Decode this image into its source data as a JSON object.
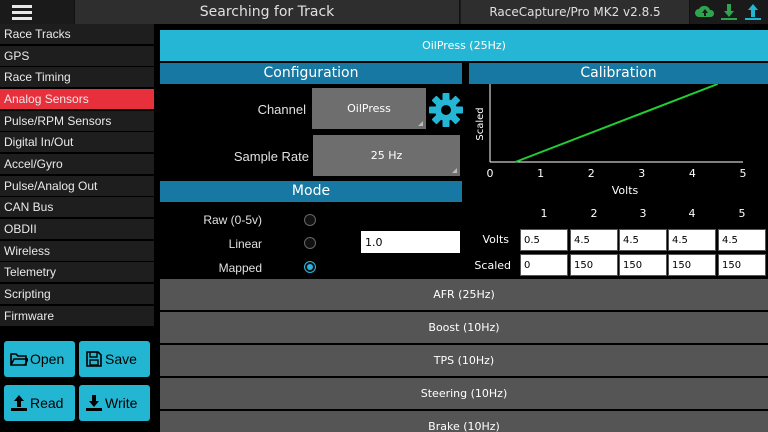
{
  "topbar": {
    "title": "Searching for Track",
    "version": "RaceCapture/Pro MK2 v2.8.5",
    "icons": [
      "menu-icon",
      "cloud-upload-icon",
      "download-icon",
      "upload-icon"
    ]
  },
  "sidebar": {
    "items": [
      {
        "label": "Race Tracks",
        "active": false
      },
      {
        "label": "GPS",
        "active": false
      },
      {
        "label": "Race Timing",
        "active": false
      },
      {
        "label": "Analog Sensors",
        "active": true
      },
      {
        "label": "Pulse/RPM Sensors",
        "active": false
      },
      {
        "label": "Digital In/Out",
        "active": false
      },
      {
        "label": "Accel/Gyro",
        "active": false
      },
      {
        "label": "Pulse/Analog Out",
        "active": false
      },
      {
        "label": "CAN Bus",
        "active": false
      },
      {
        "label": "OBDII",
        "active": false
      },
      {
        "label": "Wireless",
        "active": false
      },
      {
        "label": "Telemetry",
        "active": false
      },
      {
        "label": "Scripting",
        "active": false
      },
      {
        "label": "Firmware",
        "active": false
      }
    ],
    "buttons": {
      "open": "Open",
      "save": "Save",
      "read": "Read",
      "write": "Write"
    }
  },
  "channel": {
    "header": "OilPress (25Hz)"
  },
  "config": {
    "title": "Configuration",
    "channel_label": "Channel",
    "channel_value": "OilPress",
    "sample_rate_label": "Sample Rate",
    "sample_rate_value": "25 Hz"
  },
  "mode": {
    "title": "Mode",
    "options": [
      {
        "label": "Raw (0-5v)",
        "selected": false
      },
      {
        "label": "Linear",
        "selected": false
      },
      {
        "label": "Mapped",
        "selected": true
      }
    ],
    "linear_value": "1.0"
  },
  "calibration": {
    "title": "Calibration",
    "columns": [
      "1",
      "2",
      "3",
      "4",
      "5"
    ],
    "rows": [
      {
        "label": "Volts",
        "values": [
          "0.5",
          "4.5",
          "4.5",
          "4.5",
          "4.5"
        ]
      },
      {
        "label": "Scaled",
        "values": [
          "0",
          "150",
          "150",
          "150",
          "150"
        ]
      }
    ]
  },
  "chart_data": {
    "type": "line",
    "xlabel": "Volts",
    "ylabel": "Scaled",
    "xticks": [
      "0",
      "1",
      "2",
      "3",
      "4",
      "5"
    ],
    "xlim": [
      0,
      5
    ],
    "ylim": [
      0,
      150
    ],
    "series": [
      {
        "x": [
          0.5,
          4.5
        ],
        "values": [
          0,
          150
        ],
        "color": "#22cc33"
      }
    ]
  },
  "other_channels": [
    {
      "label": "AFR (25Hz)"
    },
    {
      "label": "Boost (10Hz)"
    },
    {
      "label": "TPS (10Hz)"
    },
    {
      "label": "Steering (10Hz)"
    },
    {
      "label": "Brake (10Hz)"
    }
  ],
  "colors": {
    "accent": "#24b6d4",
    "section": "#1779a3",
    "active_item": "#e8303c",
    "top_icons": "#2ea44f"
  }
}
